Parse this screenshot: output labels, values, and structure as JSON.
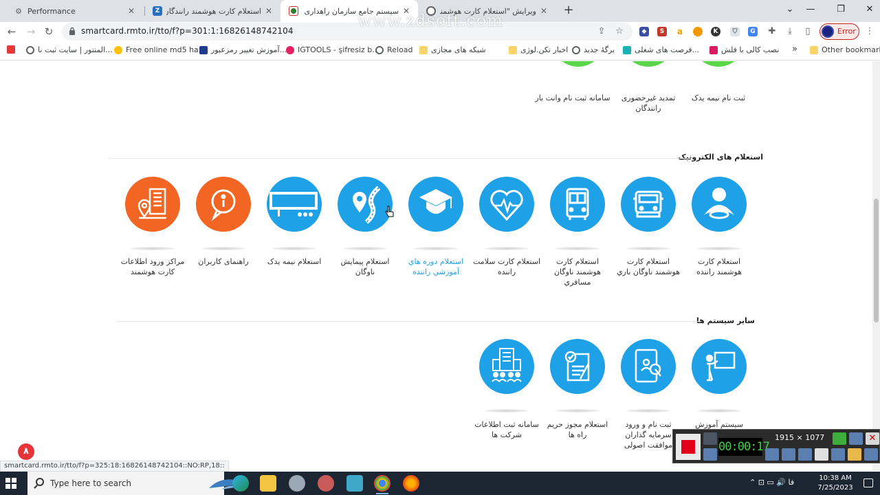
{
  "browser": {
    "tabs": [
      {
        "title": "Performance",
        "favicon": "performance-icon",
        "color": "#5f6368"
      },
      {
        "title": "استعلام کارت هوشمند رانندگان بار",
        "favicon": "z-icon",
        "color": "#2a6fbd"
      },
      {
        "title": "سیستم جامع سازمان راهداری و حمل",
        "favicon": "emblem-icon",
        "color": "#c0392b"
      },
      {
        "title": "ویرایش \"استعلام کارت هوشمند رانن",
        "favicon": "wordpress-icon",
        "color": "#5f6368"
      }
    ],
    "url": "smartcard.rmto.ir/tto/f?p=301:1:16826148742104",
    "error_label": "Error",
    "watermark": "www.zdsoft.com",
    "bookmarks": [
      "المنتور | سایت ثبت نا...",
      "Free online md5 ha...",
      "آموزش تغییر رمزعبور...",
      "IGTOOLS - şifresiz b...",
      "Reload",
      "شبکه های مجازی",
      "اخبار تکن.لوژی",
      "برگهٔ جدید",
      "فرصت های شغلی...",
      "نصب کالی با فلش",
      "»",
      "Other bookmarks"
    ]
  },
  "top_services": [
    {
      "label": "ثبت نام نیمه یدک"
    },
    {
      "label": "تمدید غیرحضوری رانندگان"
    },
    {
      "label": "سامانه ثبت نام وانت بار"
    }
  ],
  "electronic_inquiries": {
    "title": "استعلام های الکترونیک",
    "items": [
      {
        "label": "استعلام کارت هوشمند راننده",
        "icon": "driver-icon"
      },
      {
        "label": "استعلام کارت هوشمند ناوگان باري",
        "icon": "truck-icon"
      },
      {
        "label": "استعلام کارت هوشمند ناوگان مسافري",
        "icon": "bus-icon"
      },
      {
        "label": "استعلام کارت سلامت راننده",
        "icon": "heart-icon"
      },
      {
        "label": "استعلام دوره هاي آموزشي راننده",
        "icon": "graduation-cap-icon"
      },
      {
        "label": "استعلام پیمایش ناوگان",
        "icon": "map-pin-road-icon"
      },
      {
        "label": "استعلام نیمه یدک",
        "icon": "trailer-icon"
      },
      {
        "label": "راهنمای کاربران",
        "icon": "info-icon"
      },
      {
        "label": "مراکز ورود اطلاعات کارت هوشمند",
        "icon": "building-location-icon"
      }
    ]
  },
  "other_systems": {
    "title": "سایر سیستم ها",
    "items": [
      {
        "label": "سیستم آموزش",
        "icon": "teacher-board-icon"
      },
      {
        "label": "ثبت نام و ورود سرمایه گذاران موافقت اصولی",
        "icon": "tablet-key-icon"
      },
      {
        "label": "استعلام مجوز حریم راه ها",
        "icon": "document-check-icon"
      },
      {
        "label": "سامانه ثبت اطلاعات شرکت ها",
        "icon": "company-building-icon"
      }
    ]
  },
  "status_url": "smartcard.rmto.ir/tto/f?p=325:18:16826148742104::NO:RP,18::",
  "badge_number": "۸",
  "recorder": {
    "timer": "00:00:17",
    "size": "1915 × 1077"
  },
  "taskbar": {
    "search_placeholder": "Type here to search",
    "lang": "فا",
    "time": "10:38 AM",
    "date": "7/25/2023"
  },
  "colors": {
    "accent_blue": "#1ea1e6",
    "accent_orange": "#f26522",
    "green": "#5bd64a"
  }
}
